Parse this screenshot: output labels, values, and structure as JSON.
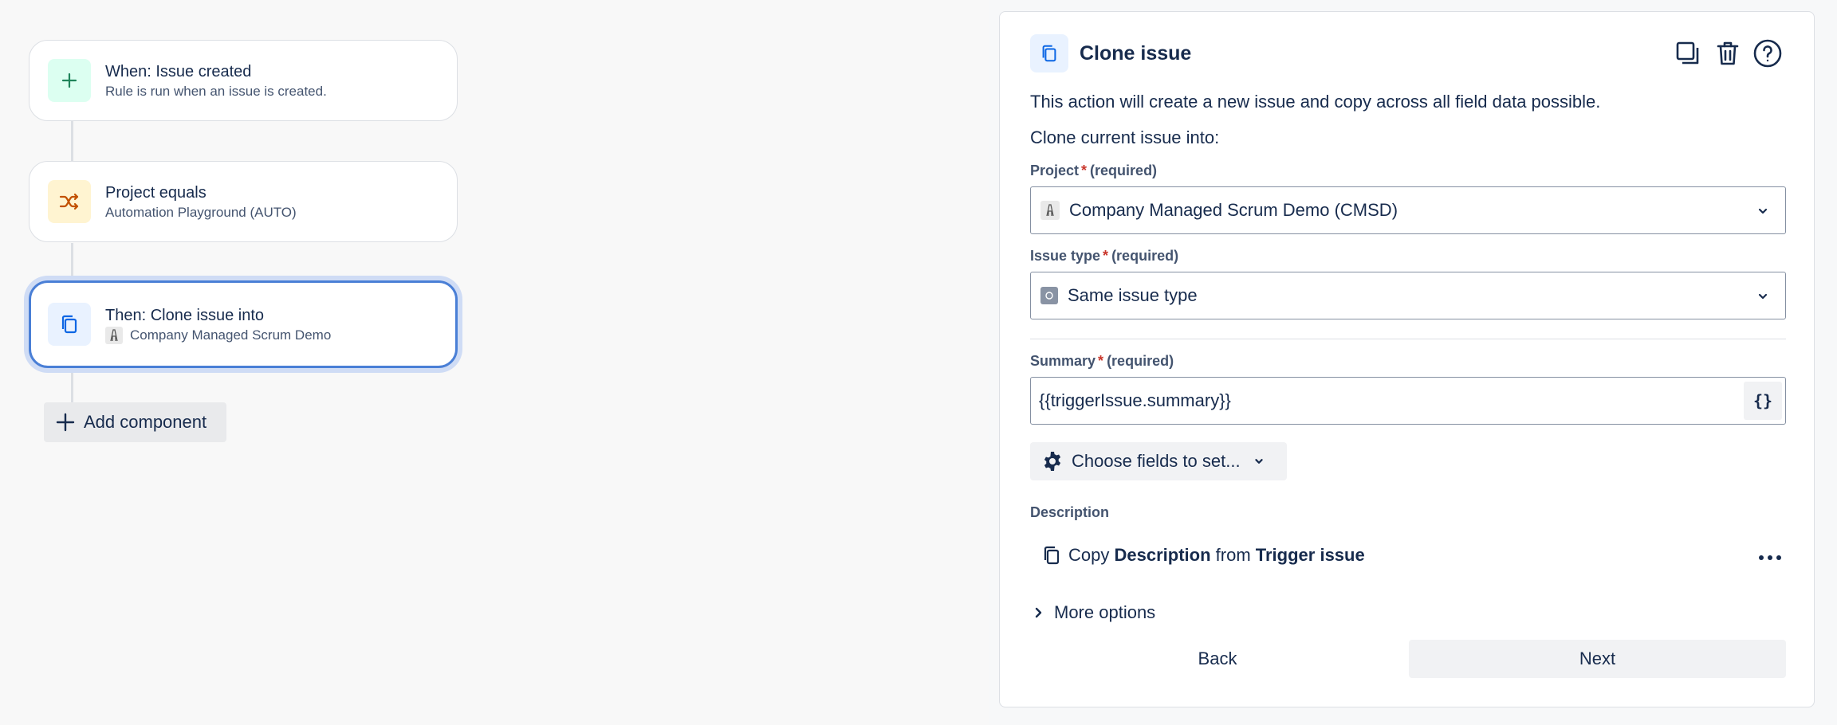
{
  "rule": {
    "trigger": {
      "title": "When: Issue created",
      "subtitle": "Rule is run when an issue is created."
    },
    "condition": {
      "title": "Project equals",
      "subtitle": "Automation Playground (AUTO)"
    },
    "action": {
      "title": "Then: Clone issue into",
      "subtitle": "Company Managed Scrum Demo"
    },
    "add_component_label": "Add component"
  },
  "panel": {
    "title": "Clone issue",
    "description": "This action will create a new issue and copy across all field data possible.",
    "clone_into_label": "Clone current issue into:",
    "project": {
      "label": "Project",
      "required_text": "(required)",
      "value": "Company Managed Scrum Demo (CMSD)"
    },
    "issue_type": {
      "label": "Issue type",
      "required_text": "(required)",
      "value": "Same issue type"
    },
    "summary": {
      "label": "Summary",
      "required_text": "(required)",
      "value": "{{triggerIssue.summary}}",
      "smart_value_label": "{}"
    },
    "choose_fields_label": "Choose fields to set...",
    "description_field": {
      "label": "Description",
      "copy_word": "Copy",
      "field_name": "Description",
      "from_word": "from",
      "source": "Trigger issue"
    },
    "more_options_label": "More options",
    "back_label": "Back",
    "next_label": "Next"
  },
  "colors": {
    "accent_selected": "#4a7fd6",
    "required_star": "#c9372c"
  },
  "icons": [
    "plus-icon",
    "shuffle-icon",
    "copy-icon",
    "duplicate-icon",
    "trash-icon",
    "help-icon",
    "chevron-down-icon",
    "gear-icon",
    "more-icon",
    "chevron-right-icon"
  ]
}
